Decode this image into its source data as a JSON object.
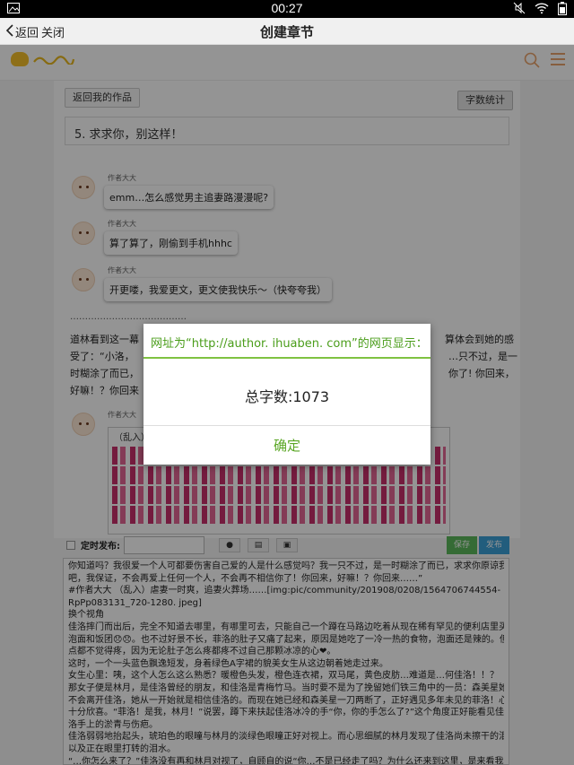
{
  "status_bar": {
    "time": "00:27"
  },
  "title_bar": {
    "back_label": "返回",
    "close_label": "关闭",
    "title": "创建章节"
  },
  "toolbar_top": {
    "back_to_works": "返回我的作品",
    "word_count_button": "字数统计"
  },
  "chapter_title": "5. 求求你，别这样！",
  "messages": [
    {
      "author": "作者大大",
      "text": "emm…怎么感觉男主追妻路漫漫呢?"
    },
    {
      "author": "作者大大",
      "text": "算了算了，刚偷到手机hhhc"
    },
    {
      "author": "作者大大",
      "text": "开更喽，我爱更文，更文使我快乐～（快夸夸我）"
    }
  ],
  "story": {
    "dots": "…………………………………",
    "line1_left": "道林看到这一幕",
    "line1_right": "算体会到她的感",
    "line2_left": "受了：“小洛，",
    "line2_right": "…只不过，是一",
    "line3_left": "时糊涂了而已，",
    "line3_right": "你了! 你回来，",
    "line4_left": "好嘛！？你回来",
    "author4": "作者大大",
    "pattern_label": "（乱入）"
  },
  "dialog": {
    "title": "网址为“http://author. ihuaben. com”的网页显示：",
    "message": "总字数:1073",
    "ok": "确定"
  },
  "bottom_toolbar": {
    "timed_publish": "定时发布:",
    "save": "保存",
    "publish": "发布"
  },
  "editor_text": [
    "你知道吗？我很爱一个人可都要伤害自己爱的人是什么感觉吗？我一只不过，是一时糊涂了而已，求求你原谅我",
    "吧，我保证，不会再爱上任何一个人，不会再不相信你了！你回来，好嘛！？你回来……”",
    "#作者大大 （乱入）虐妻一时爽，追妻火葬场……[img:pic/community/201908/0208/1564706744554-",
    "RpPp083131_720-1280. jpeg]",
    "换个视角",
    "佳洛摔门而出后，完全不知道去哪里，有哪里可去，只能自己一个蹲在马路边吃着从现在稀有罕见的便利店里买的",
    "泡面和饭团😞😞。也不过好景不长，菲洛的肚子又痛了起来，原因是她吃了一冷一热的食物，泡面还是辣的。但她一",
    "点都不觉得疼，因为无论肚子怎么疼都疼不过自己那颗冰凉的心❤。",
    "这时，一个一头蓝色飘逸短发，身着绿色A字裙的貌美女生从这边朝着她走过来。",
    "女生心里：咦，这个人怎么这么熟悉？暖橙色头发，橙色连衣裙，双马尾，黄色皮肪…难道是…何佳洛！！？",
    "那女子便是林月，是佳洛曾经的朋友，和佳洛是青梅竹马。当时要不是为了挽留她们铁三角中的一员：森美星她也",
    "不会离开佳洛，她从一开始就是相信佳洛的。而现在她已经和森美星一刀两断了，正好遇见多年未见的菲洛！心里",
    "十分欣喜。“菲洛！是我，林月！”说罢，蹲下来扶起佳洛冰冷的手“你，你的手怎么了?”这个角度正好能看见佳",
    "洛手上的淤青与伤疤。",
    "佳洛弱弱地抬起头，琥珀色的眼瞳与林月的淡绿色眼瞳正好对视上。而心思细腻的林月发现了佳洛尚未擦干的泪痕",
    "以及正在眼里打转的泪水。",
    "“…你怎么来了？”佳洛没有再和林月对视了，自顾自的说“你…不是已经走了吗？为什么还来到这里，是来看我"
  ]
}
